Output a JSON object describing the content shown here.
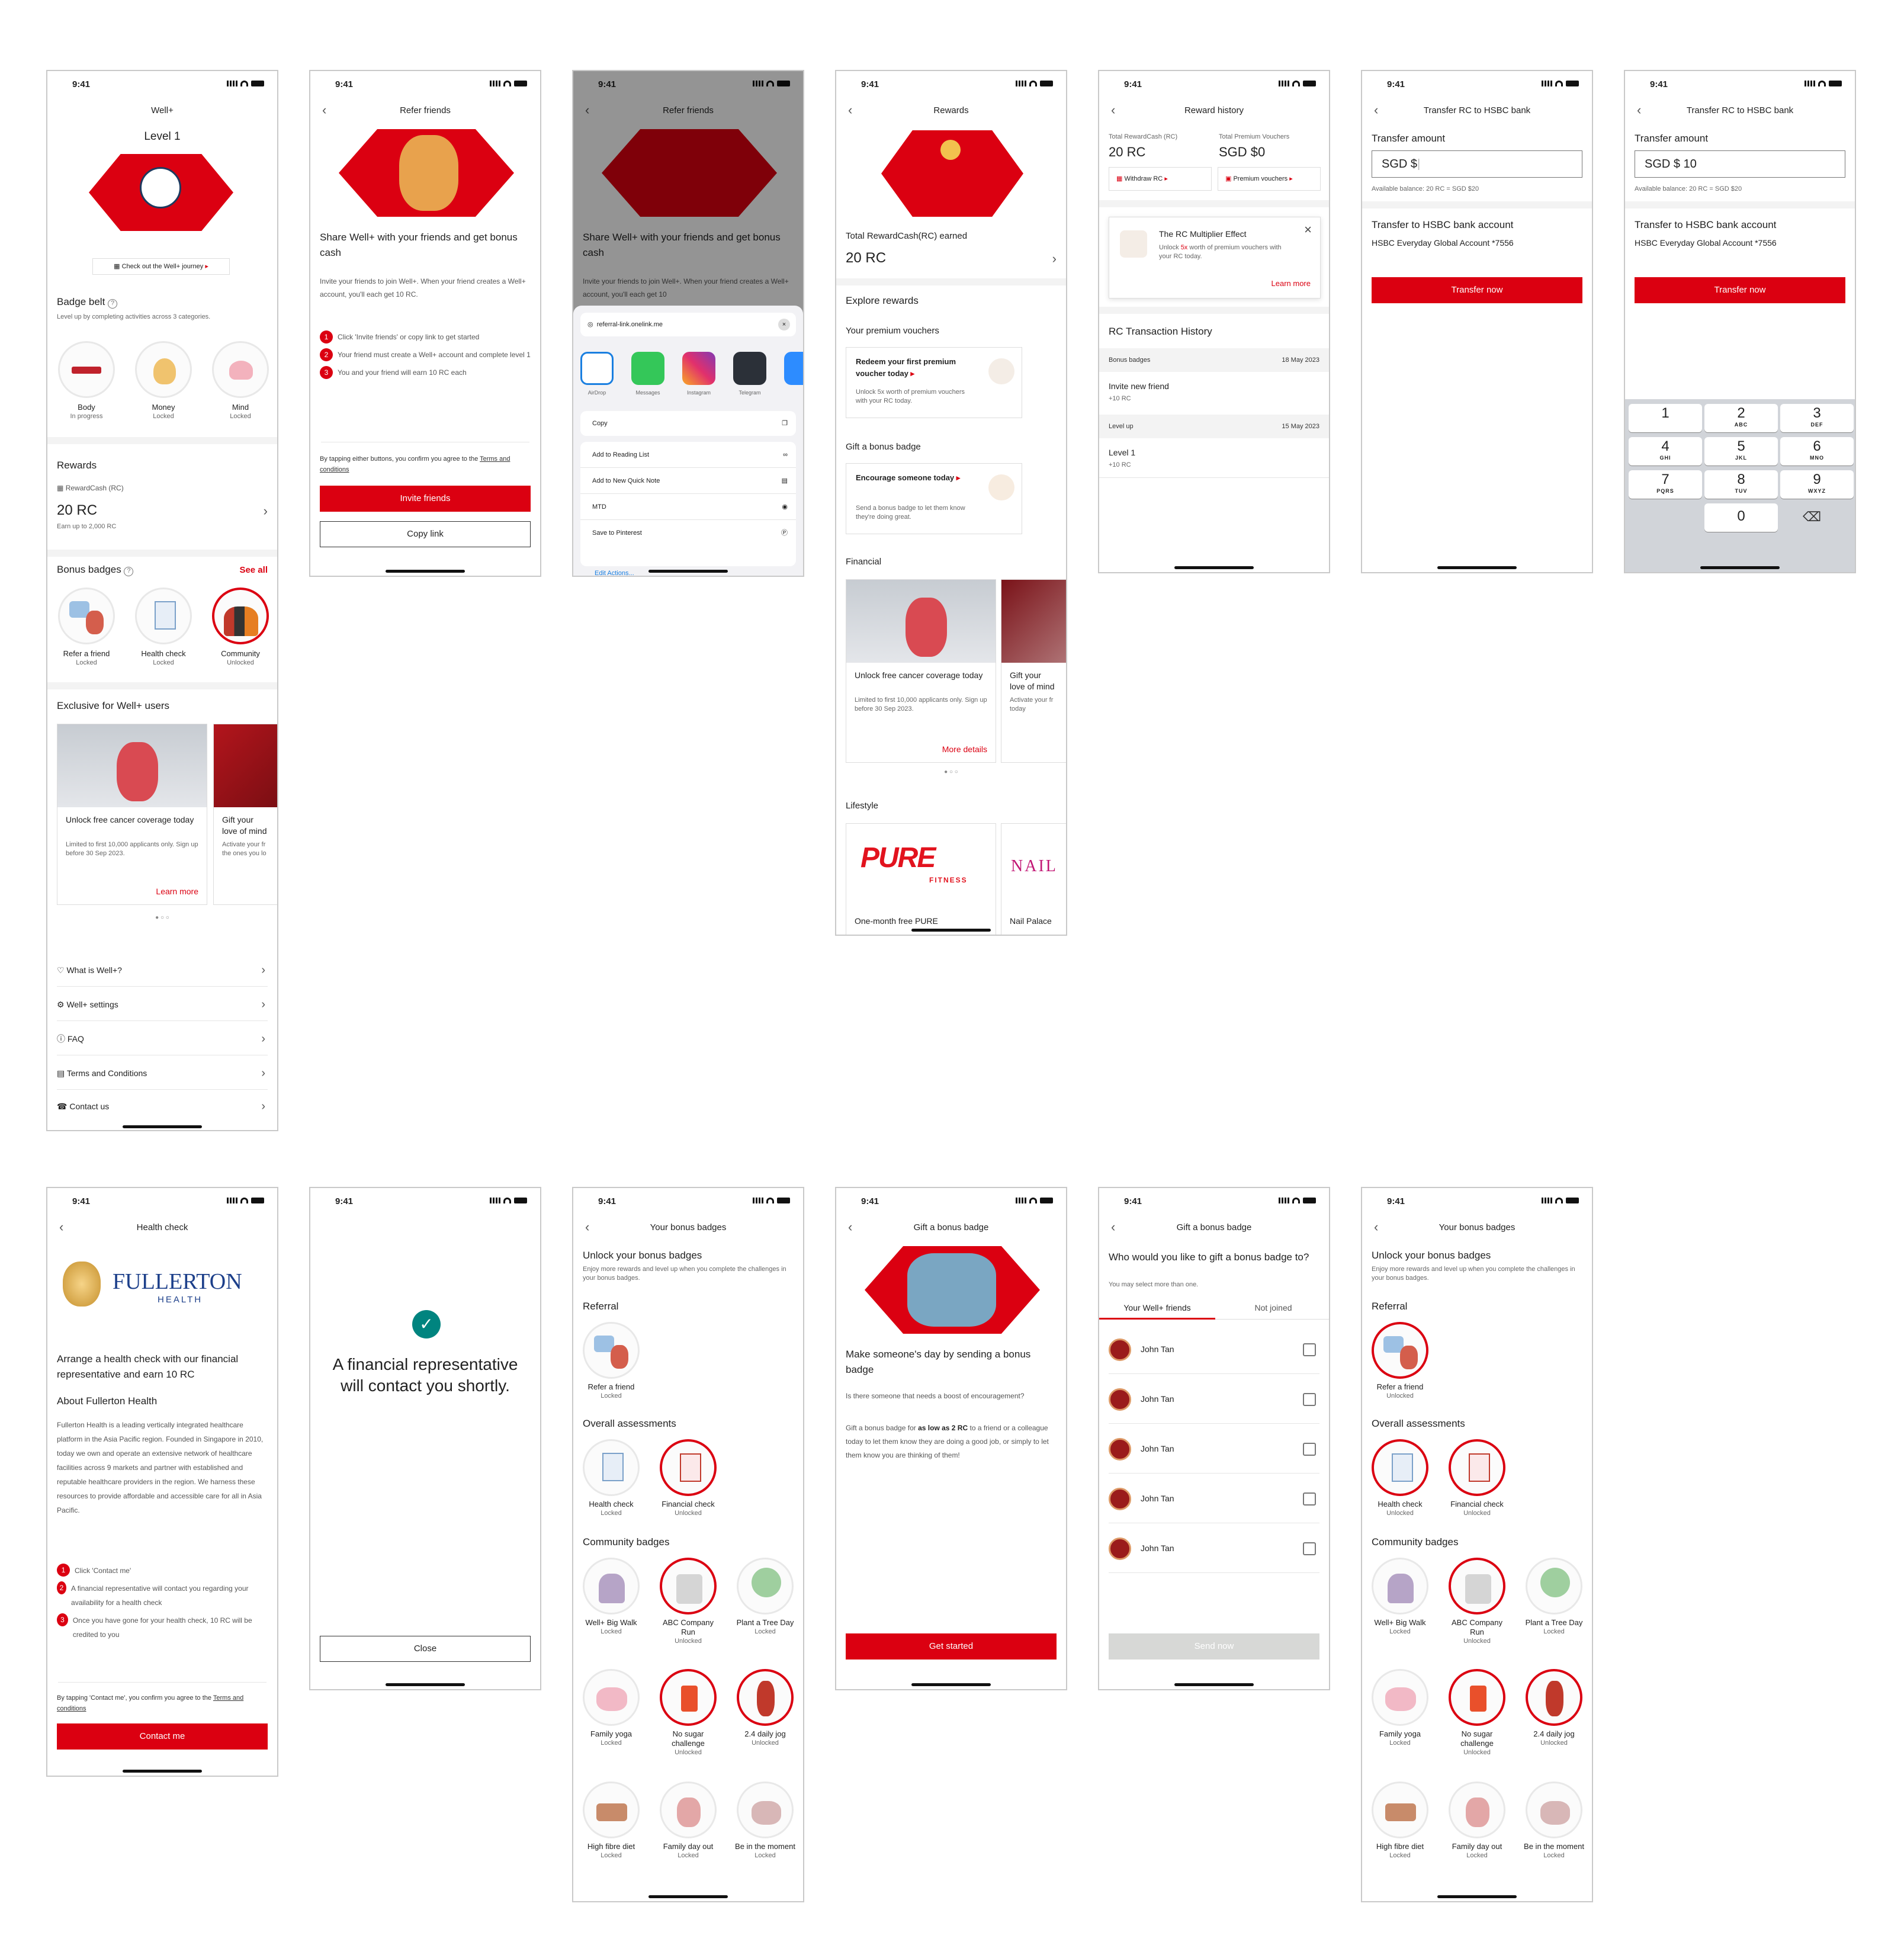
{
  "status_time": "9:41",
  "s1": {
    "title": "Well+",
    "level": "Level 1",
    "journey": "Check out the Well+ journey",
    "badge_belt": "Badge belt",
    "badge_belt_sub": "Level up by completing activities across 3 categories.",
    "belt": [
      {
        "name": "Body",
        "status": "In progress"
      },
      {
        "name": "Money",
        "status": "Locked"
      },
      {
        "name": "Mind",
        "status": "Locked"
      }
    ],
    "rewards": "Rewards",
    "rc_label": "RewardCash (RC)",
    "rc_value": "20 RC",
    "rc_sub": "Earn up to 2,000 RC",
    "bonus_badges": "Bonus badges",
    "see_all": "See all",
    "bonus": [
      {
        "name": "Refer a friend",
        "status": "Locked"
      },
      {
        "name": "Health check",
        "status": "Locked"
      },
      {
        "name": "Community",
        "status": "Unlocked"
      }
    ],
    "exclusive": "Exclusive for Well+ users",
    "card1_title": "Unlock free cancer coverage today",
    "card1_body": "Limited to first 10,000 applicants only. Sign up before 30 Sep 2023.",
    "card1_link": "Learn more",
    "card2_title": "Gift your love of mind",
    "card2_body": "Activate your fr the ones you lo",
    "menu": [
      "What is Well+?",
      "Well+ settings",
      "FAQ",
      "Terms and Conditions",
      "Contact us"
    ]
  },
  "s2": {
    "title": "Refer friends",
    "headline": "Share Well+ with your friends and get bonus cash",
    "body": "Invite your friends to join Well+. When your friend creates a Well+ account, you'll each get 10 RC.",
    "steps": [
      "Click 'Invite friends' or copy link to get started",
      "Your friend must create a Well+ account and complete level 1",
      "You and your friend will earn 10 RC each"
    ],
    "consent": "By tapping either buttons, you confirm you agree to the",
    "terms": "Terms and conditions",
    "invite": "Invite friends",
    "copy": "Copy link"
  },
  "s3": {
    "title": "Refer friends",
    "headline": "Share Well+ with your friends and get bonus cash",
    "body": "Invite your friends to join Well+. When your friend creates a Well+ account, you'll each get 10",
    "url": "referral-link.onelink.me",
    "apps": [
      "AirDrop",
      "Messages",
      "Instagram",
      "Telegram"
    ],
    "actions": [
      "Copy",
      "Add to Reading List",
      "Add to New Quick Note",
      "MTD",
      "Save to Pinterest"
    ],
    "edit": "Edit Actions..."
  },
  "s4": {
    "title": "Rewards",
    "earned": "Total RewardCash(RC) earned",
    "earned_value": "20 RC",
    "explore": "Explore rewards",
    "vouchers": "Your premium vouchers",
    "v_title": "Redeem your first premium voucher today",
    "v_body": "Unlock 5x worth of premium vouchers with your RC today.",
    "gift": "Gift a bonus badge",
    "g_title": "Encourage someone today",
    "g_body": "Send a bonus badge to let them know they're doing great.",
    "financial": "Financial",
    "f1_title": "Unlock free cancer coverage today",
    "f1_body": "Limited to first 10,000 applicants only. Sign up before 30 Sep 2023.",
    "f1_link": "More details",
    "f2_title": "Gift your love of mind",
    "f2_body": "Activate your fr today",
    "lifestyle": "Lifestyle",
    "pure": "PURE",
    "fitness": "FITNESS",
    "pure_title": "One-month free PURE",
    "nail": "NAIL",
    "nail_title": "Nail Palace"
  },
  "s5": {
    "title": "Reward history",
    "total_rc_label": "Total RewardCash (RC)",
    "total_rc": "20 RC",
    "total_v_label": "Total Premium Vouchers",
    "total_v": "SGD $0",
    "withdraw": "Withdraw RC",
    "premium": "Premium vouchers",
    "mult_title": "The RC Multiplier Effect",
    "mult_pre": "Unlock",
    "mult_x": "5x",
    "mult_body": "worth of premium vouchers with your RC today.",
    "learn": "Learn more",
    "history": "RC Transaction History",
    "groups": [
      {
        "name": "Bonus badges",
        "date": "18 May 2023",
        "item": "Invite new friend",
        "amt": "+10 RC"
      },
      {
        "name": "Level up",
        "date": "15 May 2023",
        "item": "Level 1",
        "amt": "+10 RC"
      }
    ]
  },
  "s6": {
    "title": "Transfer RC to HSBC bank",
    "amount_label": "Transfer amount",
    "amount": "SGD $",
    "balance": "Available balance: 20 RC = SGD $20",
    "to_label": "Transfer to HSBC bank account",
    "account": "HSBC Everyday Global Account *7556",
    "cta": "Transfer now"
  },
  "s7": {
    "title": "Transfer RC to HSBC bank",
    "amount_label": "Transfer amount",
    "amount": "SGD $ 10",
    "balance": "Available balance: 20 RC = SGD $20",
    "to_label": "Transfer to HSBC bank account",
    "account": "HSBC Everyday Global Account *7556",
    "cta": "Transfer now",
    "keys": [
      {
        "n": "1",
        "l": ""
      },
      {
        "n": "2",
        "l": "ABC"
      },
      {
        "n": "3",
        "l": "DEF"
      },
      {
        "n": "4",
        "l": "GHI"
      },
      {
        "n": "5",
        "l": "JKL"
      },
      {
        "n": "6",
        "l": "MNO"
      },
      {
        "n": "7",
        "l": "PQRS"
      },
      {
        "n": "8",
        "l": "TUV"
      },
      {
        "n": "9",
        "l": "WXYZ"
      },
      {
        "n": "0",
        "l": ""
      }
    ]
  },
  "s8": {
    "title": "Health check",
    "logo": "FULLERTON",
    "logo_sub": "HEALTH",
    "headline": "Arrange a health check with our financial representative and earn 10 RC",
    "about": "About Fullerton Health",
    "body": "Fullerton Health is a leading vertically integrated healthcare platform in the Asia Pacific region. Founded in Singapore in 2010, today we own and operate an extensive network of healthcare facilities across 9 markets and partner with established and reputable healthcare providers in the region. We harness these resources to provide affordable and accessible care for all in Asia Pacific.",
    "steps": [
      "Click 'Contact me'",
      "A financial representative will contact you regarding your availability for a health check",
      "Once you have gone for your health check, 10 RC will be credited to you"
    ],
    "consent": "By tapping 'Contact me', you confirm you agree to the",
    "terms": "Terms and conditions",
    "cta": "Contact me"
  },
  "s9": {
    "message": "A financial representative will contact you shortly.",
    "close": "Close"
  },
  "badges_page": {
    "title": "Your bonus badges",
    "headline": "Unlock your bonus badges",
    "sub": "Enjoy more rewards and level up when you complete the challenges in your bonus badges.",
    "referral": "Referral",
    "overall": "Overall assessments",
    "community": "Community badges"
  },
  "s10": {
    "referral": [
      {
        "name": "Refer a friend",
        "status": "Locked"
      }
    ],
    "overall": [
      {
        "name": "Health check",
        "status": "Locked"
      },
      {
        "name": "Financial check",
        "status": "Unlocked"
      }
    ],
    "community": [
      {
        "name": "Well+ Big Walk",
        "status": "Locked"
      },
      {
        "name": "ABC Company Run",
        "status": "Unlocked"
      },
      {
        "name": "Plant a Tree Day",
        "status": "Locked"
      },
      {
        "name": "Family yoga",
        "status": "Locked"
      },
      {
        "name": "No sugar challenge",
        "status": "Unlocked"
      },
      {
        "name": "2.4 daily jog",
        "status": "Unlocked"
      },
      {
        "name": "High fibre diet",
        "status": "Locked"
      },
      {
        "name": "Family day out",
        "status": "Locked"
      },
      {
        "name": "Be in the moment",
        "status": "Locked"
      }
    ]
  },
  "s11": {
    "title": "Gift a bonus badge",
    "headline": "Make someone's day by sending a bonus badge",
    "q": "Is there someone that needs a boost of encouragement?",
    "body_pre": "Gift a bonus badge for",
    "body_bold": "as low as 2 RC",
    "body_post": "to a friend or a colleague today to let them know they are doing a good job, or simply to let them know you are thinking of them!",
    "cta": "Get started"
  },
  "s12": {
    "title": "Gift a bonus badge",
    "headline": "Who would you like to gift a bonus badge to?",
    "sub": "You may select more than one.",
    "tab1": "Your Well+ friends",
    "tab2": "Not joined",
    "friends": [
      "John Tan",
      "John Tan",
      "John Tan",
      "John Tan",
      "John Tan"
    ],
    "cta": "Send now"
  },
  "s13": {
    "referral": [
      {
        "name": "Refer a friend",
        "status": "Unlocked"
      }
    ],
    "overall": [
      {
        "name": "Health check",
        "status": "Unlocked"
      },
      {
        "name": "Financial check",
        "status": "Unlocked"
      }
    ],
    "community": [
      {
        "name": "Well+ Big Walk",
        "status": "Locked"
      },
      {
        "name": "ABC Company Run",
        "status": "Unlocked"
      },
      {
        "name": "Plant a Tree Day",
        "status": "Locked"
      },
      {
        "name": "Family yoga",
        "status": "Locked"
      },
      {
        "name": "No sugar challenge",
        "status": "Unlocked"
      },
      {
        "name": "2.4 daily jog",
        "status": "Unlocked"
      },
      {
        "name": "High fibre diet",
        "status": "Locked"
      },
      {
        "name": "Family day out",
        "status": "Locked"
      },
      {
        "name": "Be in the moment",
        "status": "Locked"
      }
    ]
  },
  "colors": {
    "brand_red": "#db0011",
    "unlocked_ring": "#db0011",
    "locked_ring": "#e8e8e8"
  }
}
